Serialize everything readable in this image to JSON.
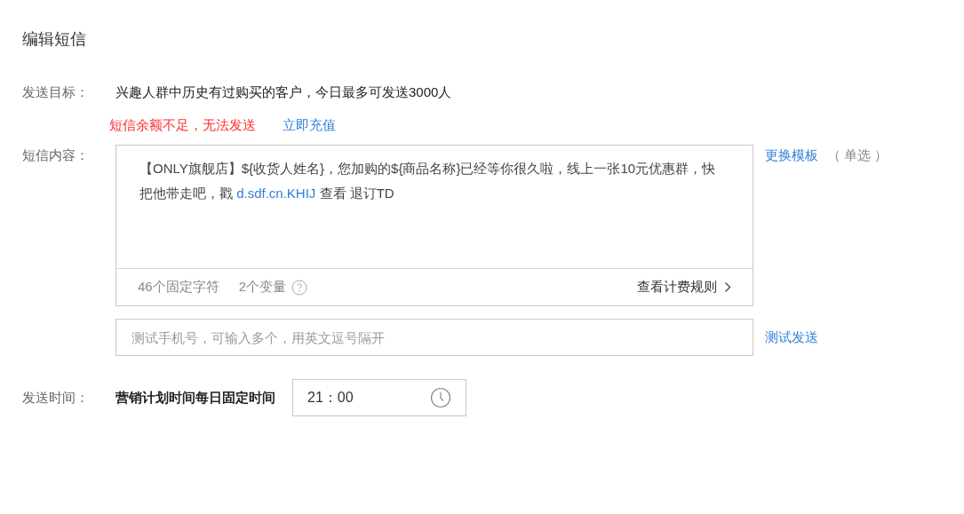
{
  "title": "编辑短信",
  "target": {
    "label": "发送目标：",
    "value": "兴趣人群中历史有过购买的客户，今日最多可发送3000人",
    "warning": "短信余额不足，无法发送",
    "recharge_link": "立即充值"
  },
  "content": {
    "label": "短信内容：",
    "message_before": "【ONLY旗舰店】${收货人姓名}，您加购的${商品名称}已经等你很久啦，线上一张10元优惠群，快把他带走吧，戳 ",
    "message_link": "d.sdf.cn.KHIJ",
    "message_after": " 查看 退订TD",
    "fixed_chars": "46个固定字符",
    "variables": "2个变量",
    "billing_link": "查看计费规则",
    "template_link": "更换模板",
    "template_note": "（ 单选 ）"
  },
  "test": {
    "placeholder": "测试手机号，可输入多个，用英文逗号隔开",
    "send_link": "测试发送"
  },
  "send_time": {
    "label": "发送时间：",
    "value": "营销计划时间每日固定时间",
    "time": "21：00"
  }
}
